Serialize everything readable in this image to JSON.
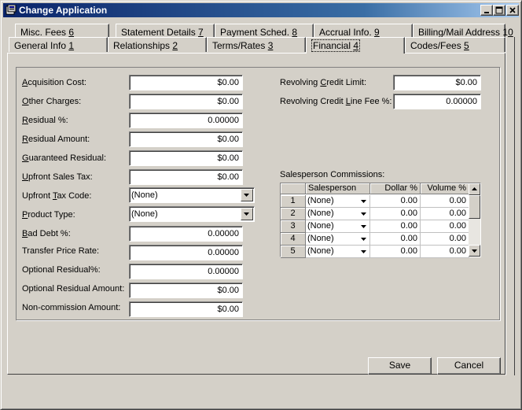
{
  "window": {
    "title": "Change Application"
  },
  "tabs_back": [
    {
      "label_pre": "Misc. Fees ",
      "key": "6",
      "label_post": ""
    },
    {
      "label_pre": "Statement Details ",
      "key": "7",
      "label_post": ""
    },
    {
      "label_pre": "Payment Sched. ",
      "key": "8",
      "label_post": ""
    },
    {
      "label_pre": "Accrual Info. ",
      "key": "9",
      "label_post": ""
    },
    {
      "label_pre": "Billing/Mail Address 1",
      "key": "0",
      "label_post": ""
    }
  ],
  "tabs_front": [
    {
      "label_pre": "General Info ",
      "key": "1",
      "label_post": ""
    },
    {
      "label_pre": "Relationships ",
      "key": "2",
      "label_post": ""
    },
    {
      "label_pre": "Terms/Rates ",
      "key": "3",
      "label_post": ""
    },
    {
      "label_pre": "Financial ",
      "key": "4",
      "label_post": ""
    },
    {
      "label_pre": "Codes/Fees ",
      "key": "5",
      "label_post": ""
    }
  ],
  "active_tab": "Financial 4",
  "left_fields": [
    {
      "label_key": "A",
      "label_rest": "cquisition Cost:",
      "value": "$0.00"
    },
    {
      "label_key": "O",
      "label_rest": "ther Charges:",
      "value": "$0.00"
    },
    {
      "label_key": "R",
      "label_rest": "esidual %:",
      "value": "0.00000"
    },
    {
      "label_key": "R",
      "label_rest": "esidual Amount:",
      "value": "$0.00"
    },
    {
      "label_key": "G",
      "label_rest": "uaranteed Residual:",
      "value": "$0.00"
    },
    {
      "label_key": "U",
      "label_rest": "pfront Sales Tax:",
      "value": "$0.00"
    }
  ],
  "upfront_tax_code": {
    "label_pre": "Upfront ",
    "label_key": "T",
    "label_post": "ax Code:",
    "value": "(None)"
  },
  "product_type": {
    "label_key": "P",
    "label_rest": "roduct Type:",
    "value": "(None)"
  },
  "left_fields_2": [
    {
      "label_key": "B",
      "label_rest": "ad Debt %:",
      "value": "0.00000"
    },
    {
      "label_key": "",
      "label_rest": "Transfer Price Rate:",
      "value": "0.00000"
    },
    {
      "label_key": "",
      "label_rest": "Optional Residual%:",
      "value": "0.00000"
    },
    {
      "label_key": "",
      "label_rest": "Optional Residual Amount:",
      "value": "$0.00"
    },
    {
      "label_key": "",
      "label_rest": "Non-commission Amount:",
      "value": "$0.00"
    }
  ],
  "revolving_credit_limit": {
    "label_pre": "Revolving ",
    "label_key": "C",
    "label_post": "redit Limit:",
    "value": "$0.00"
  },
  "revolving_credit_fee": {
    "label_pre": "Revolving Credit ",
    "label_key": "L",
    "label_post": "ine Fee %:",
    "value": "0.00000"
  },
  "commissions": {
    "title": "Salesperson Commissions:",
    "columns": [
      "Salesperson",
      "Dollar %",
      "Volume %"
    ],
    "rows": [
      {
        "num": "1",
        "salesperson": "(None)",
        "dollar": "0.00",
        "volume": "0.00"
      },
      {
        "num": "2",
        "salesperson": "(None)",
        "dollar": "0.00",
        "volume": "0.00"
      },
      {
        "num": "3",
        "salesperson": "(None)",
        "dollar": "0.00",
        "volume": "0.00"
      },
      {
        "num": "4",
        "salesperson": "(None)",
        "dollar": "0.00",
        "volume": "0.00"
      },
      {
        "num": "5",
        "salesperson": "(None)",
        "dollar": "0.00",
        "volume": "0.00"
      }
    ]
  },
  "buttons": {
    "save": "Save",
    "cancel": "Cancel"
  },
  "icons": {
    "app": "app-icon",
    "minimize": "minimize-icon",
    "maximize": "maximize-icon",
    "close": "close-icon",
    "dropdown": "chevron-down-icon",
    "scroll_up": "scroll-up-icon",
    "scroll_down": "scroll-down-icon"
  },
  "colors": {
    "title_start": "#0a246a",
    "title_end": "#a6caf0",
    "face": "#d4d0c8"
  }
}
